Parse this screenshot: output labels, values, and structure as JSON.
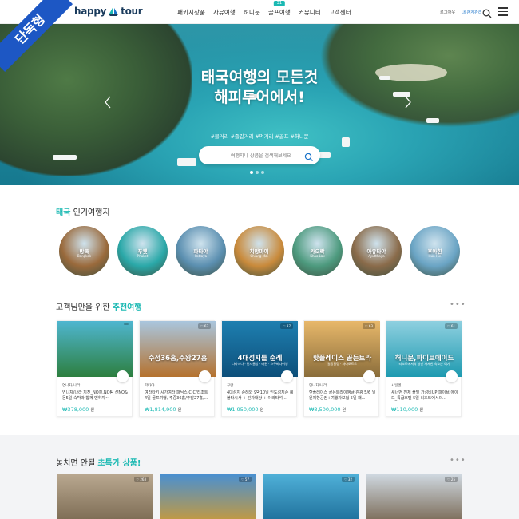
{
  "ribbon": {
    "label": "단독형"
  },
  "header": {
    "logo_text": "happy",
    "logo_text2": "tour",
    "nav": [
      {
        "label": "패키지상품"
      },
      {
        "label": "자유여행"
      },
      {
        "label": "허니문"
      },
      {
        "label": "골프여행",
        "badge": "31"
      },
      {
        "label": "커뮤니티"
      },
      {
        "label": "고객센터"
      }
    ],
    "util_login": "로그아웃",
    "util_mypage": "내 관계관리"
  },
  "hero": {
    "title_line1": "태국여행의 모든것",
    "title_line2": "해피투어에서!",
    "tags": "#물거리 #즐길거리 #먹거리 #골프 #허니문",
    "search_placeholder": "여행지나 상품을 검색해보세요",
    "slide_count": 3,
    "active_slide": 1
  },
  "popular": {
    "title_accent": "태국",
    "title_rest": " 인기여행지",
    "items": [
      {
        "name": "방콕",
        "sub": "Bangkok",
        "color": "#9a6a3c"
      },
      {
        "name": "푸켓",
        "sub": "Phuket",
        "color": "#2aa8a8"
      },
      {
        "name": "파타야",
        "sub": "Pattaya",
        "color": "#5b8fb0"
      },
      {
        "name": "치앙마이",
        "sub": "Chiang Mai",
        "color": "#c98a3b"
      },
      {
        "name": "카오락",
        "sub": "Khao Lak",
        "color": "#4d9a7e"
      },
      {
        "name": "아유타야",
        "sub": "Ayutthaya",
        "color": "#8a6b4a"
      },
      {
        "name": "후아힌",
        "sub": "Hua Hin",
        "color": "#6aa4c4"
      }
    ]
  },
  "recommended": {
    "title_rest": "고객님만을 위한 ",
    "title_accent": "추천여행",
    "more": "•••",
    "cards": [
      {
        "overlay": "",
        "overlay_sub": "",
        "category": "연나차/나라",
        "desc": "선NO&돈5일 숙박과 함께 맨하자~",
        "desc_prefix": "연나차/나라 지진_NO킬,NO팀",
        "price": "₩378,000",
        "unit": "원",
        "stat": "",
        "c1": "#4fb6d0",
        "c2": "#2d7f3f"
      },
      {
        "overlay": "수정36홈,주왕27홈",
        "overlay_sub": "",
        "category": "파타야",
        "desc_prefix": "여라타키 시가여라 파닉스.C.C/리조트",
        "desc": "4일 골프여행, 주중36홈/주말27홈,...",
        "price": "₩1,814,900",
        "unit": "원",
        "stat": "♡ 63",
        "c1": "#a9c6de",
        "c2": "#b5722e"
      },
      {
        "overlay": "4대성지를 순례",
        "overlay_sub": "나라시나 · 린자클방 · 매권 · 스쿠비다이빙",
        "category": "구란",
        "desc_prefix": "4대성지 순례와 9박10일 인도성지순",
        "desc": "례 불타시사 + 린자대당 + 이라타석...",
        "price": "₩1,950,000",
        "unit": "원",
        "stat": "♡ 37",
        "c1": "#1e7fb0",
        "c2": "#0d4f7a"
      },
      {
        "overlay": "핫플레이스 골든트라",
        "overlay_sub": "일정일정 · 사다모르트",
        "category": "연나차/나라",
        "desc_prefix": "핫플레이스 골든트라이앵글 관광 5/6",
        "desc": "일 원제항공권+여행자보험 5일 패...",
        "price": "₩3,500,000",
        "unit": "원",
        "stat": "♡ 63",
        "c1": "#e8b86a",
        "c2": "#8a6d3b"
      },
      {
        "overlay": "허니문,파이브에이드",
        "overlay_sub": "리조트에서의 낭만 자세한 숙소는 여기",
        "category": "시일엘",
        "desc_prefix": "새너먼 전체 풀빌 가성비UP 파이브",
        "desc": "에이드_특급호텔 5일 리조트에서의...",
        "price": "₩110,000",
        "unit": "원",
        "stat": "♡ 61",
        "c1": "#8fd0e0",
        "c2": "#1e9ab0"
      }
    ]
  },
  "special": {
    "title_rest": "놓치면 안될 ",
    "title_accent": "초특가 상품!",
    "more": "•••",
    "cards": [
      {
        "stat": "♡ 263",
        "c1": "#b9a890",
        "c2": "#7b6a52"
      },
      {
        "stat": "♡ 57",
        "c1": "#4a90d0",
        "c2": "#c79a3c"
      },
      {
        "stat": "♡ 32",
        "c1": "#4fb0d8",
        "c2": "#1e6f9a"
      },
      {
        "stat": "♡ 25",
        "c1": "#cfd8e0",
        "c2": "#7a6a56"
      }
    ]
  }
}
